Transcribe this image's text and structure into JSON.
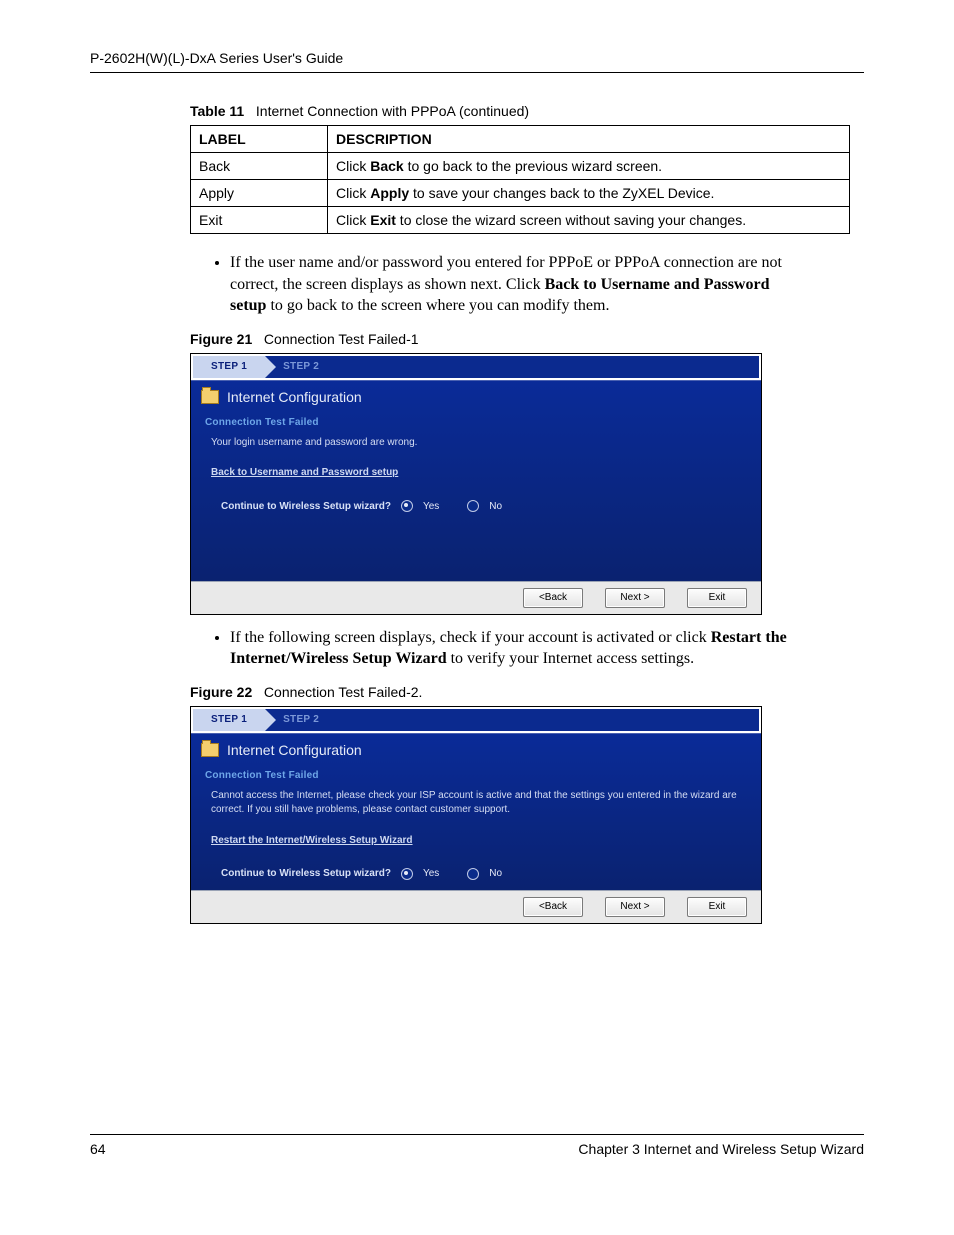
{
  "header": "P-2602H(W)(L)-DxA Series User's Guide",
  "table_caption_prefix": "Table 11",
  "table_caption_text": "Internet Connection with PPPoA (continued)",
  "table": {
    "headers": [
      "LABEL",
      "DESCRIPTION"
    ],
    "rows": [
      {
        "label": "Back",
        "desc_pre": "Click ",
        "desc_b": "Back",
        "desc_post": " to go back to the previous wizard screen."
      },
      {
        "label": "Apply",
        "desc_pre": "Click ",
        "desc_b": "Apply",
        "desc_post": " to save your changes back to the ZyXEL Device."
      },
      {
        "label": "Exit",
        "desc_pre": "Click ",
        "desc_b": "Exit",
        "desc_post": " to close the wizard screen without saving your changes."
      }
    ]
  },
  "bullet1": {
    "pre": "If the user name and/or password you entered for PPPoE or PPPoA connection are not correct, the screen displays as shown next. Click ",
    "bold": "Back to Username and Password setup",
    "post": " to go back to the screen where you can modify them."
  },
  "fig21_caption_prefix": "Figure 21",
  "fig21_caption_text": "Connection Test Failed-1",
  "fig22_caption_prefix": "Figure 22",
  "fig22_caption_text": "Connection Test Failed-2.",
  "bullet2": {
    "pre": "If the following screen displays, check if your account is activated or click ",
    "bold": "Restart the Internet/Wireless Setup Wizard",
    "post": " to verify your Internet access settings."
  },
  "wizard_common": {
    "step1": "STEP 1",
    "step2": "STEP 2",
    "title": "Internet Configuration",
    "section": "Connection Test Failed",
    "question": "Continue to Wireless Setup wizard?",
    "yes": "Yes",
    "no": "No",
    "back_btn": "<Back",
    "next_btn": "Next >",
    "exit_btn": "Exit"
  },
  "wizard1": {
    "msg": "Your login username and password are wrong.",
    "link": "Back to Username and Password setup"
  },
  "wizard2": {
    "msg": "Cannot access the Internet, please check your ISP account is active and that the settings you entered in the wizard are correct. If you still have problems, please contact customer support.",
    "link": "Restart the Internet/Wireless Setup Wizard"
  },
  "footer": {
    "page": "64",
    "chapter": "Chapter 3 Internet and Wireless Setup Wizard"
  }
}
